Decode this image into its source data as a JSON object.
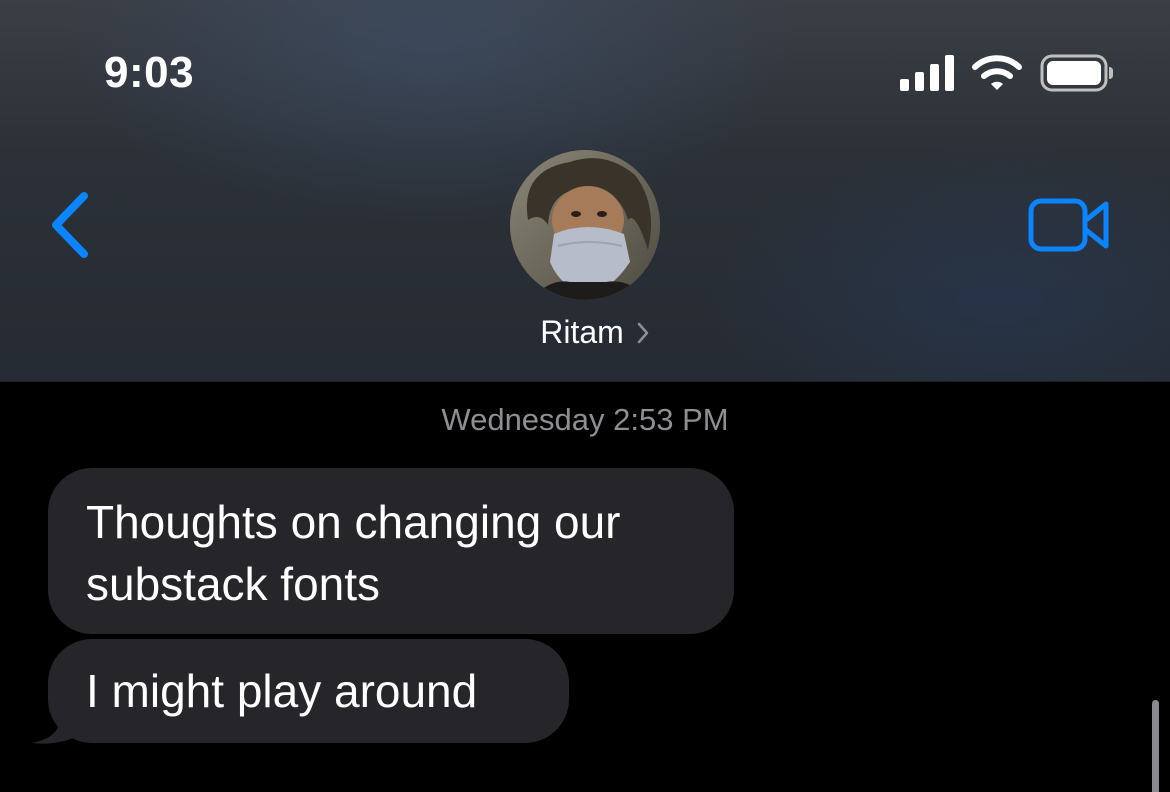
{
  "status_bar": {
    "time": "9:03",
    "signal_icon": "cellular-signal-icon",
    "wifi_icon": "wifi-icon",
    "battery_icon": "battery-icon"
  },
  "nav": {
    "back_icon": "chevron-left-icon",
    "video_icon": "video-camera-icon",
    "accent_color": "#0a84ff"
  },
  "contact": {
    "name": "Ritam",
    "disclosure": "›"
  },
  "conversation": {
    "timestamp": "Wednesday 2:53 PM",
    "messages": [
      {
        "sender": "Ritam",
        "direction": "incoming",
        "text": "Thoughts on changing our substack fonts"
      },
      {
        "sender": "Ritam",
        "direction": "incoming",
        "text": "I might play around"
      }
    ],
    "bubble_color": "#26252a",
    "background_color": "#000000"
  }
}
